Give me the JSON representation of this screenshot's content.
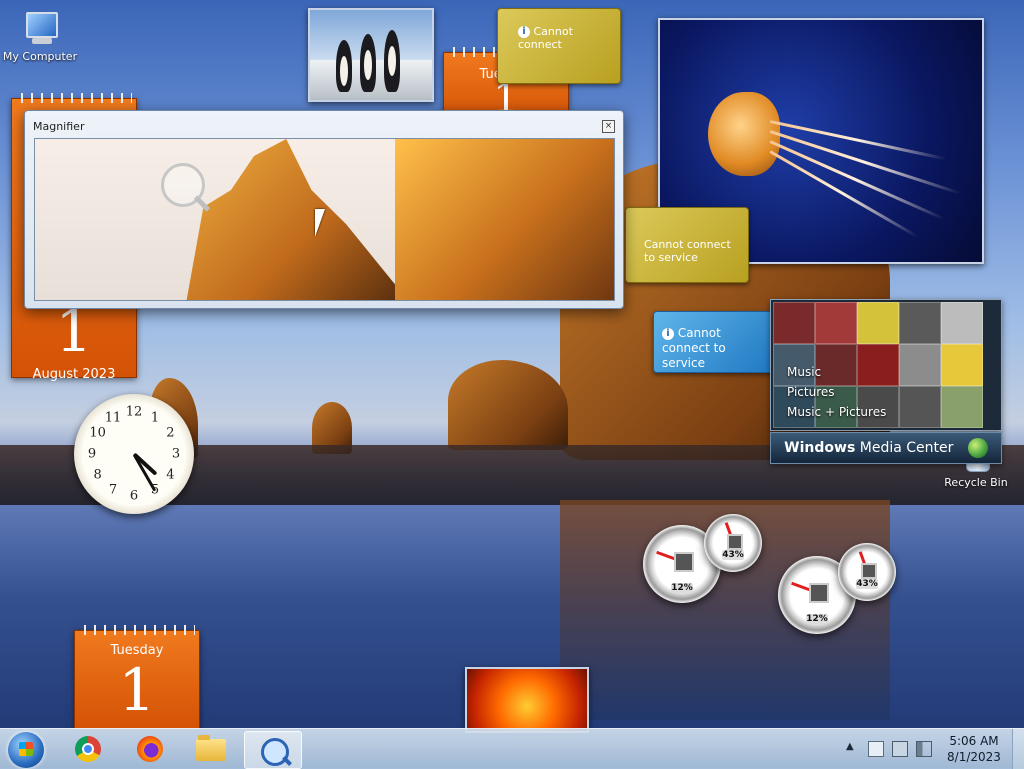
{
  "desktop": {
    "icons": [
      {
        "label": "My Computer"
      },
      {
        "label": "Recycle Bin"
      }
    ]
  },
  "calendars": [
    {
      "day": "",
      "num": "1",
      "month": "August 2023"
    },
    {
      "day": "Tuesday",
      "num": "1"
    },
    {
      "day": "Tuesday",
      "num": "1"
    }
  ],
  "magnifier": {
    "title": "Magnifier",
    "close": "×"
  },
  "feeds": {
    "gold_top": "Cannot connect",
    "gold_mid": "Cannot connect to service",
    "blue": "Cannot connect to service",
    "info": "i"
  },
  "media_center": {
    "items": [
      "Music",
      "Pictures",
      "Music + Pictures"
    ],
    "brand_bold": "Windows",
    "brand_rest": "Media Center"
  },
  "clock_gadget": {
    "numbers": [
      "12",
      "1",
      "2",
      "3",
      "4",
      "5",
      "6",
      "7",
      "8",
      "9",
      "10",
      "11"
    ],
    "hour": 4,
    "minute": 25
  },
  "cpu_meters": [
    {
      "cpu": "12%",
      "mem": "43%"
    },
    {
      "cpu": "12%",
      "mem": "43%"
    }
  ],
  "taskbar": {
    "apps": [
      "Chrome",
      "Firefox",
      "File Explorer",
      "Magnifier"
    ],
    "active_app": "Magnifier",
    "tray_arrow": "▲",
    "time": "5:06 AM",
    "date": "8/1/2023"
  }
}
